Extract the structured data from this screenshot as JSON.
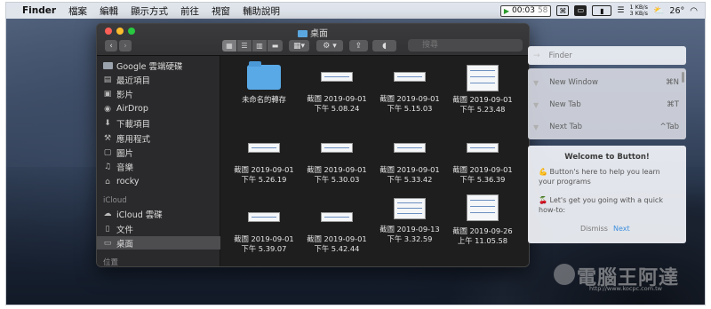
{
  "menubar": {
    "apple": "",
    "app": "Finder",
    "items": [
      "檔案",
      "編輯",
      "顯示方式",
      "前往",
      "視窗",
      "輔助說明"
    ],
    "timer": "00:03",
    "timer_secs": "58",
    "net_up": "1 KB/s",
    "net_down": "3 KB/s",
    "temperature": "26°"
  },
  "finder": {
    "title": "桌面",
    "search_placeholder": "搜尋",
    "sidebar": {
      "items": [
        {
          "label": "Google 雲端硬碟",
          "icon": "folder-icon"
        },
        {
          "label": "最近項目",
          "icon": "clock-icon"
        },
        {
          "label": "影片",
          "icon": "film-icon"
        },
        {
          "label": "AirDrop",
          "icon": "airdrop-icon"
        },
        {
          "label": "下載項目",
          "icon": "download-icon"
        },
        {
          "label": "應用程式",
          "icon": "apps-icon"
        },
        {
          "label": "圖片",
          "icon": "camera-icon"
        },
        {
          "label": "音樂",
          "icon": "music-icon"
        },
        {
          "label": "rocky",
          "icon": "home-icon"
        }
      ],
      "icloud_header": "iCloud",
      "icloud_items": [
        {
          "label": "iCloud 雲碟",
          "icon": "cloud-icon"
        },
        {
          "label": "文件",
          "icon": "document-icon"
        },
        {
          "label": "桌面",
          "icon": "desktop-icon"
        }
      ],
      "locations_header": "位置"
    },
    "files": [
      {
        "line1": "未命名的轉存",
        "line2": "",
        "kind": "folder"
      },
      {
        "line1": "截圖 2019-09-01",
        "line2": "下午 5.08.24",
        "kind": "wide"
      },
      {
        "line1": "截圖 2019-09-01",
        "line2": "下午 5.15.03",
        "kind": "wide"
      },
      {
        "line1": "截圖 2019-09-01",
        "line2": "下午 5.23.48",
        "kind": "tall"
      },
      {
        "line1": "截圖 2019-09-01",
        "line2": "下午 5.26.19",
        "kind": "wide"
      },
      {
        "line1": "截圖 2019-09-01",
        "line2": "下午 5.30.03",
        "kind": "wide"
      },
      {
        "line1": "截圖 2019-09-01",
        "line2": "下午 5.33.42",
        "kind": "wide"
      },
      {
        "line1": "截圖 2019-09-01",
        "line2": "下午 5.36.39",
        "kind": "wide"
      },
      {
        "line1": "截圖 2019-09-01",
        "line2": "下午 5.39.07",
        "kind": "wide"
      },
      {
        "line1": "截圖 2019-09-01",
        "line2": "下午 5.42.44",
        "kind": "wide"
      },
      {
        "line1": "截圖 2019-09-13",
        "line2": "下午 3.32.59",
        "kind": "tall"
      },
      {
        "line1": "截圖 2019-09-26",
        "line2": "上午 11.05.58",
        "kind": "tall"
      }
    ]
  },
  "button_panel": {
    "search_text": "Finder",
    "commands": [
      {
        "label": "New Window",
        "shortcut": "⌘N"
      },
      {
        "label": "New Tab",
        "shortcut": "⌘T"
      },
      {
        "label": "Next Tab",
        "shortcut": "^Tab"
      }
    ],
    "welcome_title": "Welcome to Button!",
    "welcome_p1": "💪 Button's here to help you learn your programs",
    "welcome_p2": "🍒 Let's get you going with a quick how-to:",
    "dismiss": "Dismiss",
    "next": "Next"
  },
  "watermark": {
    "title": "電腦王阿達",
    "url": "http://www.kocpc.com.tw"
  }
}
